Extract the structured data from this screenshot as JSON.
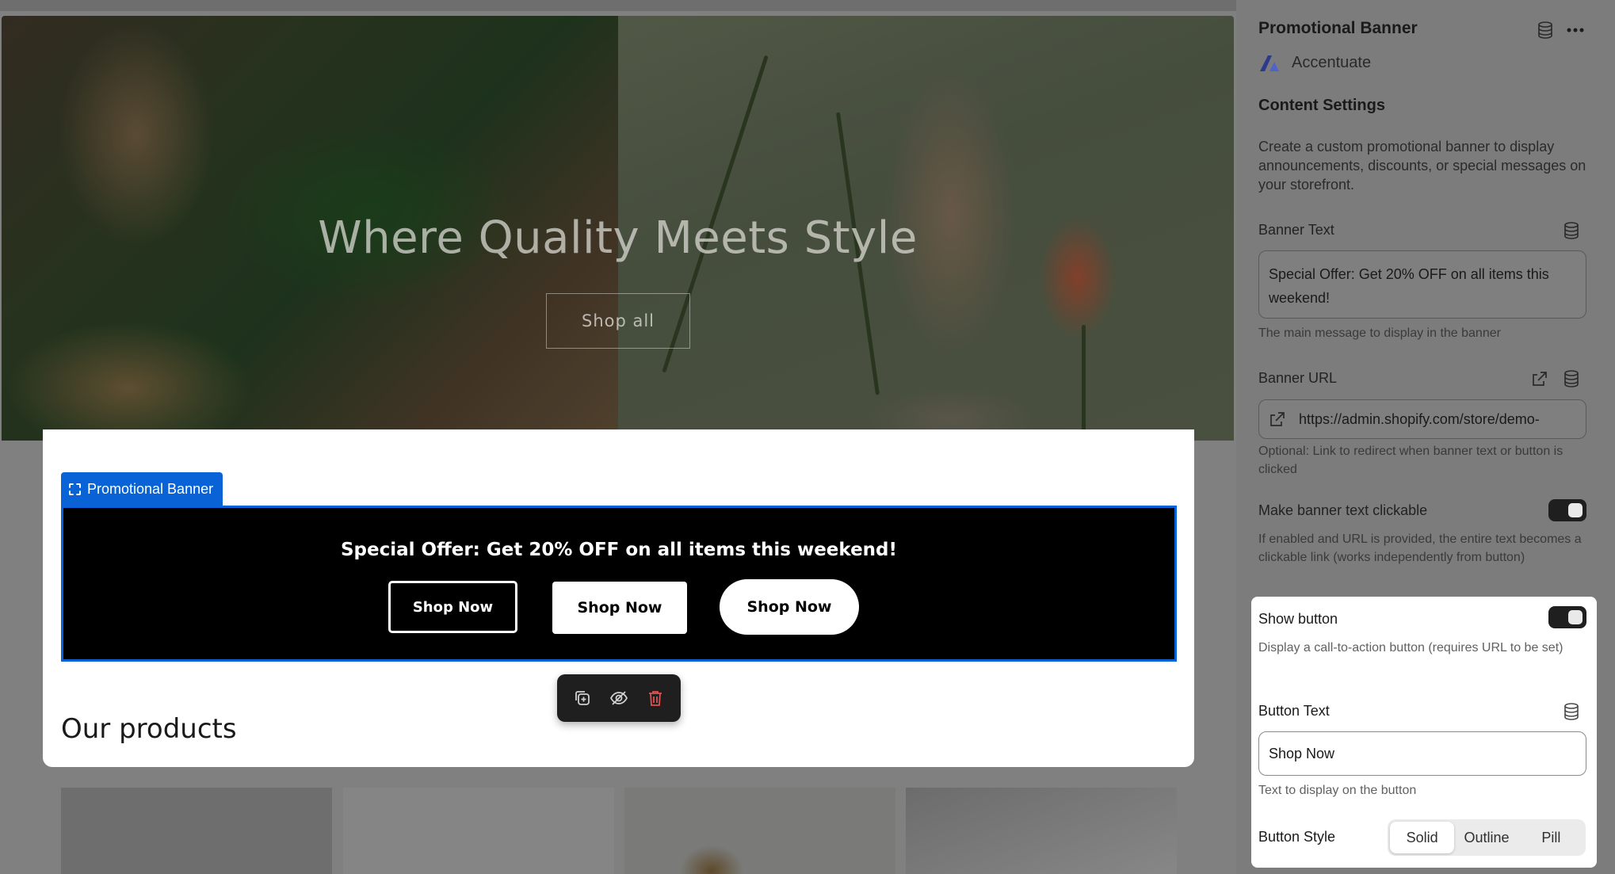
{
  "hero": {
    "title": "Where Quality Meets Style",
    "button_label": "Shop all"
  },
  "preview": {
    "selection_tag": "Promotional Banner",
    "banner_text": "Special Offer: Get 20% OFF on all items this weekend!",
    "buttons": [
      "Shop Now",
      "Shop Now",
      "Shop Now"
    ],
    "toolbar": {
      "duplicate_icon": "duplicate-icon",
      "hide_icon": "eye-off-icon",
      "delete_icon": "trash-icon"
    },
    "products_heading": "Our products"
  },
  "sidebar": {
    "title": "Promotional Banner",
    "app_name": "Accentuate",
    "section_title": "Content Settings",
    "description": "Create a custom promotional banner to display announcements, discounts, or special messages on your storefront.",
    "banner_text": {
      "label": "Banner Text",
      "value": "Special Offer: Get 20% OFF on all items this weekend!",
      "help": "The main message to display in the banner"
    },
    "banner_url": {
      "label": "Banner URL",
      "value": "https://admin.shopify.com/store/demo-",
      "help": "Optional: Link to redirect when banner text or button is clicked"
    },
    "clickable": {
      "label": "Make banner text clickable",
      "help": "If enabled and URL is provided, the entire text becomes a clickable link (works independently from button)",
      "enabled": true
    },
    "show_button": {
      "label": "Show button",
      "help": "Display a call-to-action button (requires URL to be set)",
      "enabled": true
    },
    "button_text": {
      "label": "Button Text",
      "value": "Shop Now",
      "help": "Text to display on the button"
    },
    "button_style": {
      "label": "Button Style",
      "options": [
        "Solid",
        "Outline",
        "Pill"
      ],
      "selected": "Solid"
    }
  },
  "colors": {
    "selection_blue": "#0a63d6",
    "banner_bg": "#000000",
    "delete_red": "#e05252"
  }
}
